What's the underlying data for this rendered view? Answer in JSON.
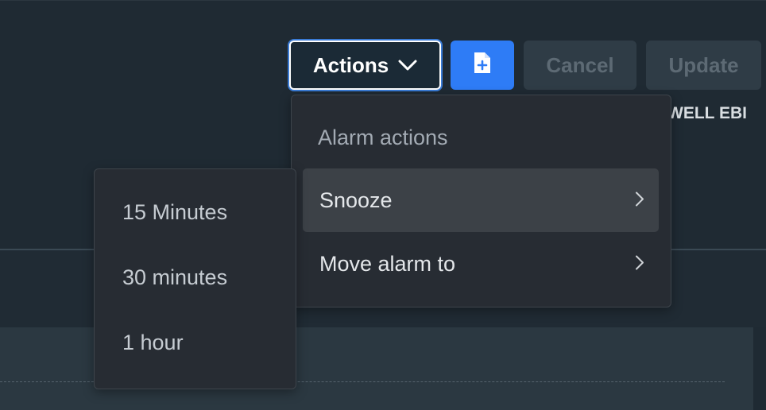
{
  "toolbar": {
    "actions_label": "Actions",
    "new_document_icon": "file-plus-icon",
    "cancel_label": "Cancel",
    "update_label": "Update"
  },
  "header_link": {
    "text": "YWELL EBI"
  },
  "actions_menu": {
    "header": "Alarm actions",
    "items": [
      {
        "label": "Snooze",
        "icon": "chevron-right-icon",
        "active": true
      },
      {
        "label": "Move alarm to",
        "icon": "chevron-right-icon",
        "active": false
      }
    ]
  },
  "snooze_submenu": {
    "items": [
      {
        "label": "15 Minutes"
      },
      {
        "label": "30 minutes"
      },
      {
        "label": "1 hour"
      }
    ]
  },
  "colors": {
    "background": "#1f2a33",
    "primary": "#2e7cf6",
    "menu_bg": "#272c33",
    "menu_active": "#3c4147",
    "disabled_button": "#2f3c46"
  }
}
